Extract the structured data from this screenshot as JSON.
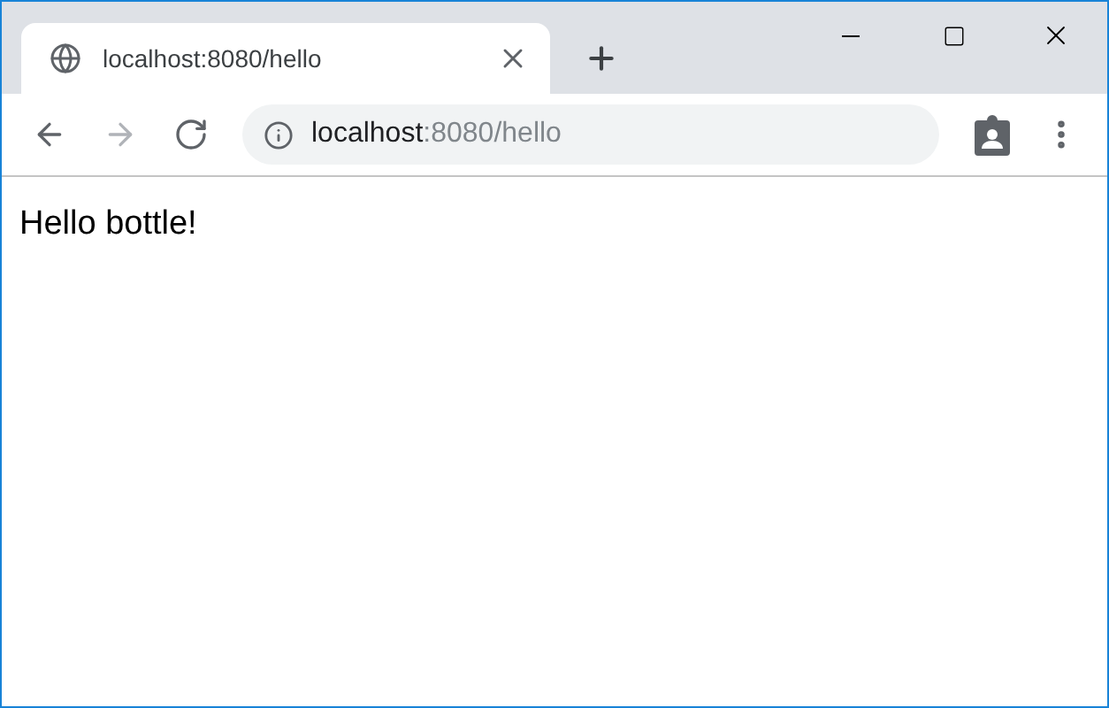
{
  "tabs": [
    {
      "title": "localhost:8080/hello",
      "selected": true
    }
  ],
  "nav": {
    "back_disabled": false,
    "forward_disabled": true
  },
  "address_bar": {
    "host": "localhost",
    "path": ":8080/hello"
  },
  "page": {
    "text": "Hello bottle!"
  }
}
